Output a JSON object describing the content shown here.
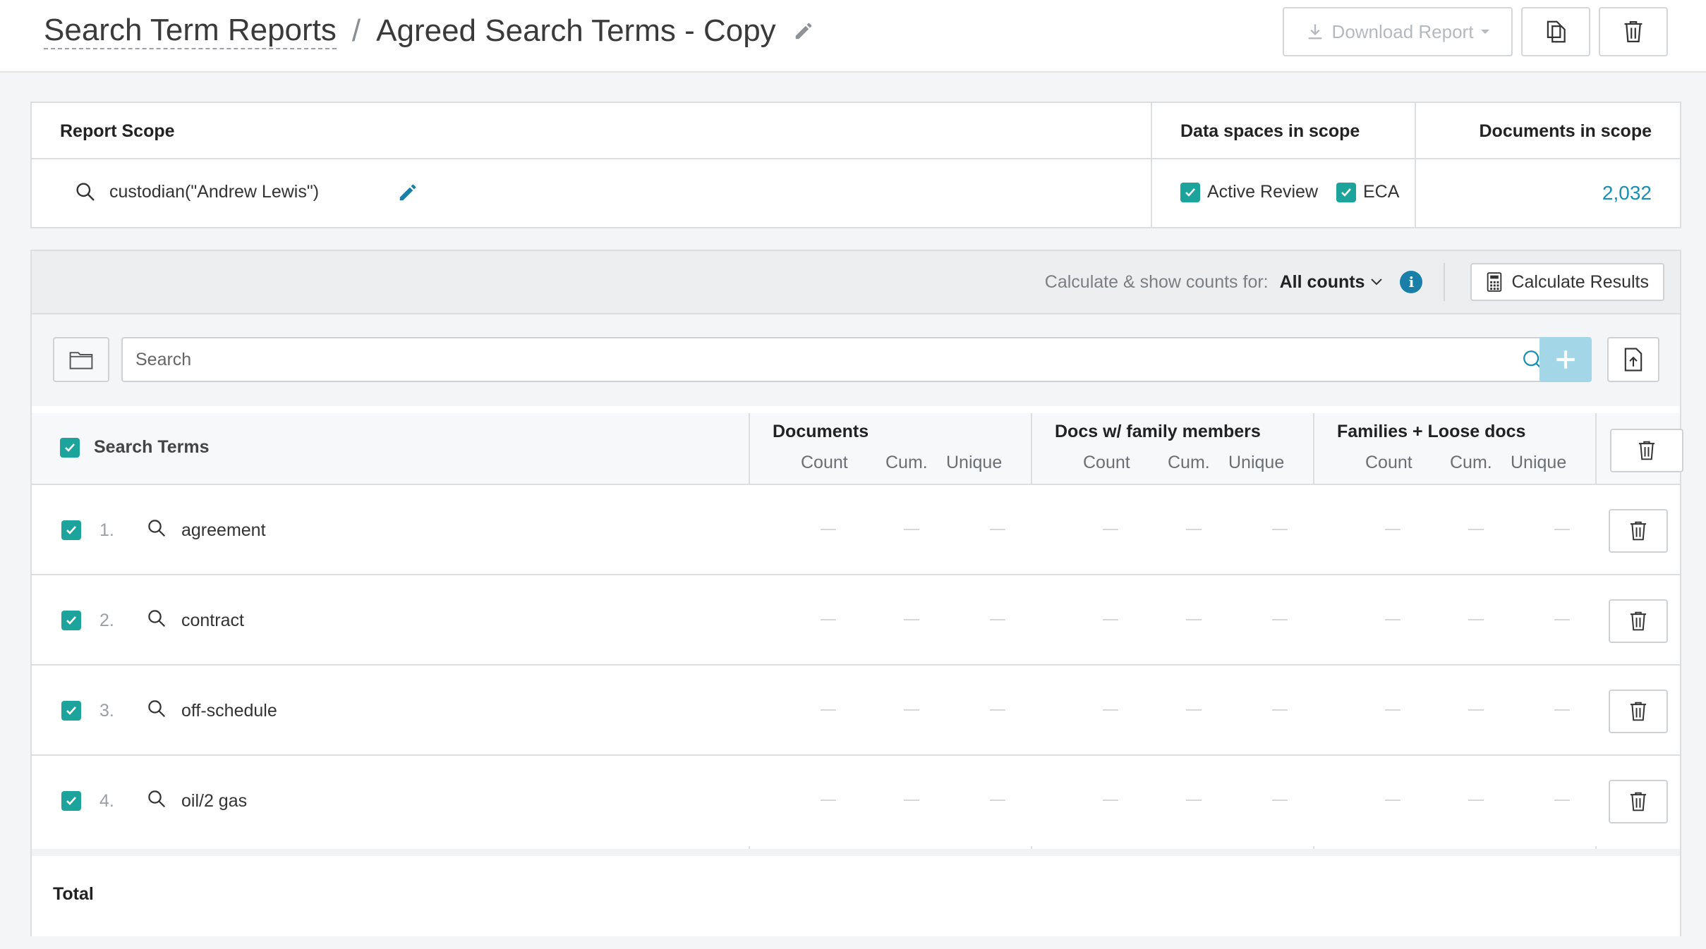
{
  "header": {
    "breadcrumb_parent": "Search Term Reports",
    "separator": "/",
    "title": "Agreed Search Terms - Copy",
    "download_label": "Download Report"
  },
  "scope": {
    "report_scope_label": "Report Scope",
    "data_spaces_label": "Data spaces in scope",
    "documents_label": "Documents in scope",
    "query": "custodian(\"Andrew Lewis\")",
    "spaces": [
      {
        "label": "Active Review",
        "checked": true
      },
      {
        "label": "ECA",
        "checked": true
      }
    ],
    "documents_count": "2,032"
  },
  "toolbar": {
    "calc_label": "Calculate & show counts for:",
    "calc_value": "All counts",
    "info_glyph": "i",
    "calculate_button": "Calculate Results"
  },
  "search": {
    "placeholder": "Search",
    "add_glyph": "+"
  },
  "table": {
    "title_column": "Search Terms",
    "groups": [
      {
        "name": "Documents",
        "cols": [
          "Count",
          "Cum.",
          "Unique"
        ]
      },
      {
        "name": "Docs w/ family members",
        "cols": [
          "Count",
          "Cum.",
          "Unique"
        ]
      },
      {
        "name": "Families + Loose docs",
        "cols": [
          "Count",
          "Cum.",
          "Unique"
        ]
      }
    ],
    "rows": [
      {
        "num": "1.",
        "term": "agreement",
        "checked": true
      },
      {
        "num": "2.",
        "term": "contract",
        "checked": true
      },
      {
        "num": "3.",
        "term": "off-schedule",
        "checked": true
      },
      {
        "num": "4.",
        "term": "oil/2 gas",
        "checked": true
      }
    ],
    "total_label": "Total"
  },
  "colors": {
    "accent_teal": "#1ba39c",
    "link_blue": "#1a8fb5",
    "add_button_disabled": "#a3d6e7"
  }
}
